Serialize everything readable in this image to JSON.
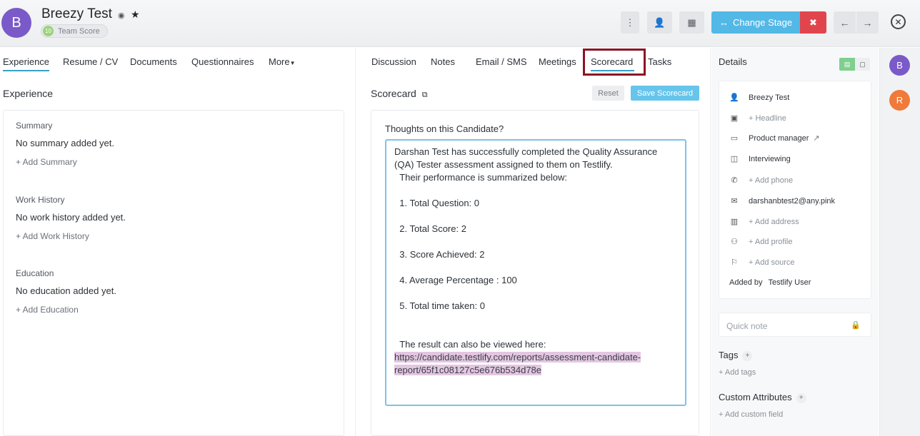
{
  "header": {
    "avatar_letter": "B",
    "candidate_name": "Breezy Test",
    "team_score_num": "10",
    "team_score_label": "Team Score",
    "change_stage_label": "Change Stage"
  },
  "left_tabs": [
    "Experience",
    "Resume / CV",
    "Documents",
    "Questionnaires",
    "More"
  ],
  "experience": {
    "title": "Experience",
    "summary_label": "Summary",
    "summary_text": "No summary added yet.",
    "summary_add": "+ Add Summary",
    "work_label": "Work History",
    "work_text": "No work history added yet.",
    "work_add": "+ Add Work History",
    "edu_label": "Education",
    "edu_text": "No education added yet.",
    "edu_add": "+ Add Education"
  },
  "mid_tabs": [
    "Discussion",
    "Notes",
    "Email / SMS",
    "Meetings",
    "Scorecard",
    "Tasks"
  ],
  "scorecard": {
    "title": "Scorecard",
    "reset_label": "Reset",
    "save_label": "Save Scorecard",
    "question": "Thoughts on this Candidate?",
    "body": "Darshan Test has successfully completed the Quality Assurance (QA) Tester assessment assigned to them on Testlify.\n  Their performance is summarized below:\n\n  1. Total Question: 0\n\n  2. Total Score: 2\n\n  3. Score Achieved: 2\n\n  4. Average Percentage : 100\n\n  5. Total time taken: 0\n\n\n  The result can also be viewed here:\n",
    "url": "https://candidate.testlify.com/reports/assessment-candidate-report/65f1c08127c5e676b534d78e"
  },
  "details": {
    "title": "Details",
    "name": "Breezy Test",
    "headline": "+ Headline",
    "position": "Product manager",
    "stage": "Interviewing",
    "phone": "+ Add phone",
    "email": "darshanbtest2@any.pink",
    "address": "+ Add address",
    "profile": "+ Add profile",
    "source": "+ Add source",
    "added_by_label": "Added by",
    "added_by_value": "Testlify User",
    "quick_note": "Quick note",
    "tags_label": "Tags",
    "add_tags": "+ Add tags",
    "custom_label": "Custom Attributes",
    "add_custom": "+ Add custom field"
  },
  "user_avatars": [
    {
      "letter": "B",
      "color": "#7a5ac8"
    },
    {
      "letter": "R",
      "color": "#ef7a3a"
    }
  ]
}
